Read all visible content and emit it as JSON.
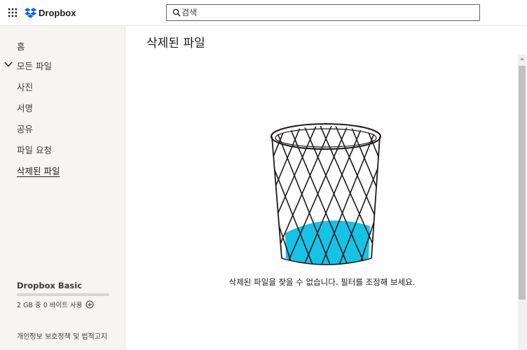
{
  "header": {
    "brand": "Dropbox",
    "search_placeholder": "검색",
    "colors": {
      "brand_blue": "#0061fe",
      "search_border": "#636363"
    }
  },
  "sidebar": {
    "items": [
      {
        "label": "홈"
      },
      {
        "label": "모든 파일"
      },
      {
        "label": "사진"
      },
      {
        "label": "서명"
      },
      {
        "label": "공유"
      },
      {
        "label": "파일 요청"
      },
      {
        "label": "삭제된 파일"
      }
    ],
    "active_item": "삭제된 파일",
    "plan": {
      "name": "Dropbox Basic",
      "usage_text": "2 GB 중 0 바이트 사용",
      "usage_fraction": 0
    },
    "footer_link": "개인정보 보호정책 및 법적고지"
  },
  "main": {
    "title": "삭제된 파일",
    "empty_message": "삭제된 파일을 찾을 수 없습니다. 필터를 조정해 보세요.",
    "illustration": "empty-trash-basket-icon",
    "colors": {
      "water": "#16c2e6",
      "ink": "#1e1919"
    }
  }
}
